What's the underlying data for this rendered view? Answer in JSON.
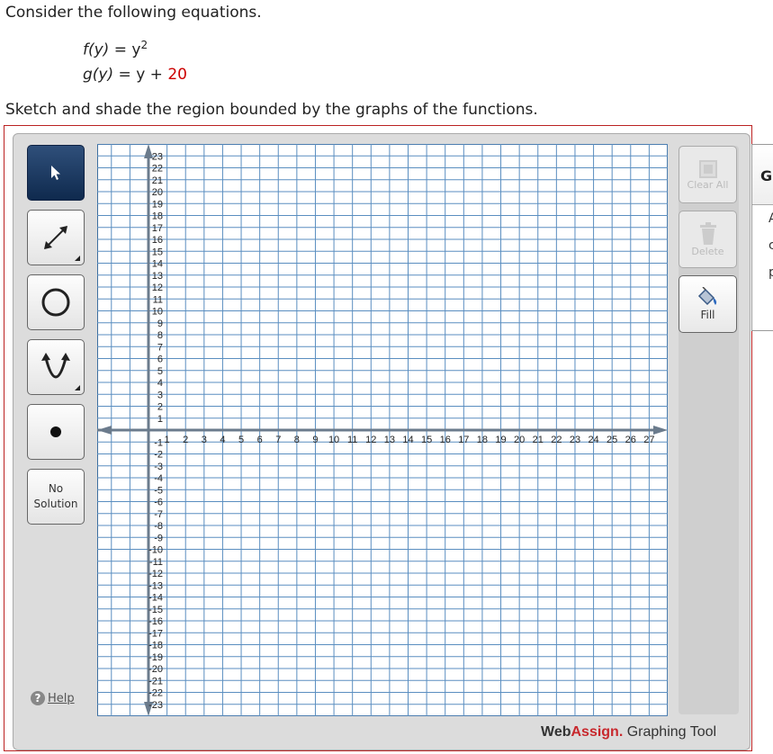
{
  "question": {
    "intro": "Consider the following equations.",
    "eq1": {
      "lhs": "f(y)",
      "eq": "=",
      "base": "y",
      "exp": "2"
    },
    "eq2": {
      "lhs": "g(y)",
      "eq": "=",
      "base": "y",
      "plus": " + ",
      "constant": "20"
    },
    "instruction": "Sketch and shade the region bounded by the graphs of the functions."
  },
  "tools": {
    "select_icon": "arrow-pointer-icon",
    "line_icon": "line-segment-icon",
    "circle_icon": "circle-icon",
    "parabola_icon": "parabola-icon",
    "point_icon": "point-icon",
    "no_solution_line1": "No",
    "no_solution_line2": "Solution",
    "help_label": "Help",
    "help_icon": "?"
  },
  "right_tools": {
    "clear_all_label": "Clear All",
    "delete_label": "Delete",
    "fill_label": "Fill"
  },
  "side_panel": {
    "title": "Gr",
    "lines": [
      "A",
      "c",
      "p"
    ]
  },
  "graph": {
    "x_min": 0,
    "x_max": 28,
    "y_min": -24,
    "y_max": 24,
    "x_tick_labels": [
      "1",
      "2",
      "3",
      "4",
      "5",
      "6",
      "7",
      "8",
      "9",
      "10",
      "11",
      "12",
      "13",
      "14",
      "15",
      "16",
      "17",
      "18",
      "19",
      "20",
      "21",
      "22",
      "23",
      "24",
      "25",
      "26",
      "27"
    ],
    "y_tick_labels_positive": [
      "1",
      "2",
      "3",
      "4",
      "5",
      "6",
      "7",
      "8",
      "9",
      "10",
      "11",
      "12",
      "13",
      "14",
      "15",
      "16",
      "17",
      "18",
      "19",
      "20",
      "21",
      "22",
      "23"
    ],
    "y_tick_labels_negative": [
      "-1",
      "-2",
      "-3",
      "-4",
      "-5",
      "-6",
      "-7",
      "-8",
      "-9",
      "-10",
      "-11",
      "-12",
      "-13",
      "-14",
      "-15",
      "-16",
      "-17",
      "-18",
      "-19",
      "-20",
      "-21",
      "-22",
      "-23"
    ],
    "grid_color": "#5a8ec0",
    "axis_color": "#6b7b8c"
  },
  "brand": {
    "part1": "Web",
    "part2": "Assign.",
    "part3": " Graphing Tool"
  },
  "colors": {
    "active_tool": "#1a3a64",
    "brand_red": "#c8282d",
    "border_red": "#b22222"
  }
}
